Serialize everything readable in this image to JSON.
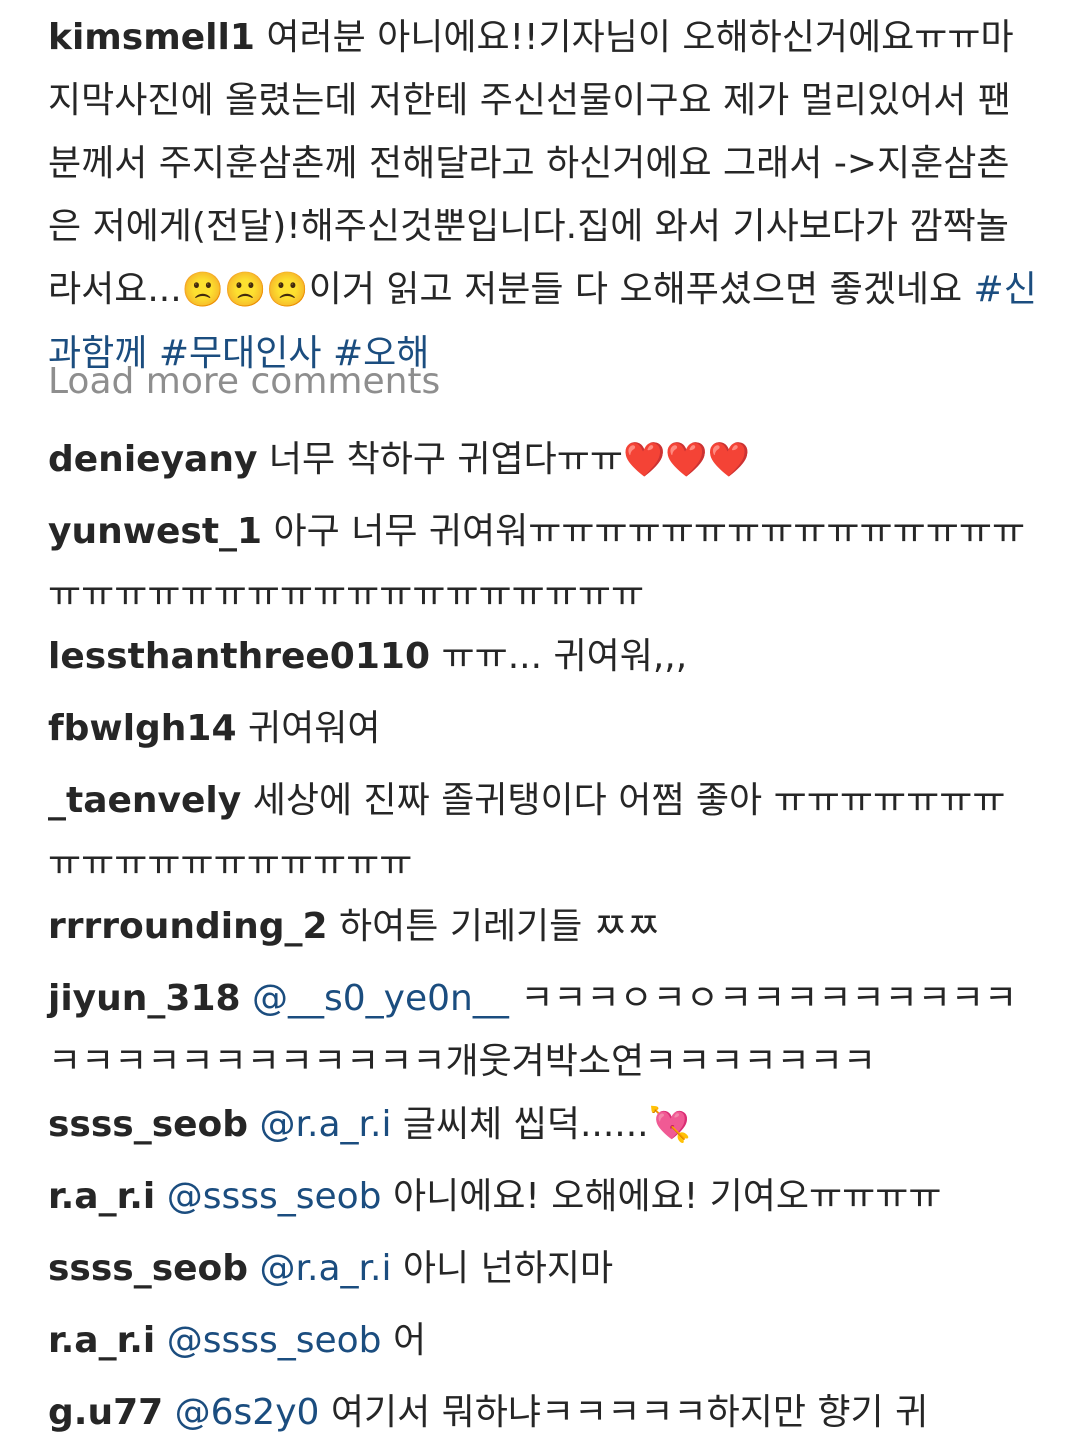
{
  "caption": {
    "username": "kimsmell1",
    "text_part1": "여러분 아니에요!!기자님이 오해하신거에요ㅠㅠ마지막사진에 올렸는데 저한테 주신선물이구요 제가 멀리있어서 팬분께서 주지훈삼촌께 전해달라고 하신거에요 그래서 ->지훈삼촌은 저에게(전달)!해주신것뿐입니다.집에 와서 기사보다가 깜짝놀라서요...",
    "emojis": "🙁🙁🙁",
    "text_part2": "이거 읽고 저분들 다 오해푸셨으면 좋겠네요 ",
    "hashtags": [
      "#신과함께",
      "#무대인사",
      "#오해"
    ]
  },
  "load_more_label": "Load more comments",
  "comments": [
    {
      "username": "denieyany",
      "mention": "",
      "text": "너무 착하구 귀엽다ㅠㅠ",
      "emoji": "❤️❤️❤️"
    },
    {
      "username": "yunwest_1",
      "mention": "",
      "text": "아구 너무 귀여워ㅠㅠㅠㅠㅠㅠㅠㅠㅠㅠㅠㅠㅠㅠㅠㅠㅠㅠㅠㅠㅠㅠㅠㅠㅠㅠㅠㅠㅠㅠㅠㅠㅠ",
      "emoji": ""
    },
    {
      "username": "lessthanthree0110",
      "mention": "",
      "text": "ㅠㅠ... 귀여워,,,",
      "emoji": ""
    },
    {
      "username": "fbwlgh14",
      "mention": "",
      "text": "귀여워여",
      "emoji": ""
    },
    {
      "username": "_taenvely",
      "mention": "",
      "text": "세상에 진짜 졸귀탱이다 어쩜 좋아 ㅠㅠㅠㅠㅠㅠㅠㅠㅠㅠㅠㅠㅠㅠㅠㅠㅠㅠ",
      "emoji": ""
    },
    {
      "username": "rrrrounding_2",
      "mention": "",
      "text": "하여튼 기레기들 ㅉㅉ",
      "emoji": ""
    },
    {
      "username": "jiyun_318",
      "mention": "@__s0_ye0n__",
      "text": "ㅋㅋㅋㅇㅋㅇㅋㅋㅋㅋㅋㅋㅋㅋㅋㅋㅋㅋㅋㅋㅋㅋㅋㅋㅋㅋㅋ개웃겨박소연ㅋㅋㅋㅋㅋㅋㅋ",
      "emoji": ""
    },
    {
      "username": "ssss_seob",
      "mention": "@r.a_r.i",
      "text": "글씨체 씹덕......",
      "emoji": "💘"
    },
    {
      "username": "r.a_r.i",
      "mention": "@ssss_seob",
      "text": "아니에요! 오해에요! 기여오ㅠㅠㅠㅠ",
      "emoji": ""
    },
    {
      "username": "ssss_seob",
      "mention": "@r.a_r.i",
      "text": "아니 넌하지마",
      "emoji": ""
    },
    {
      "username": "r.a_r.i",
      "mention": "@ssss_seob",
      "text": "어",
      "emoji": ""
    },
    {
      "username": "g.u77",
      "mention": "@6s2y0",
      "text": "여기서 뭐하냐ㅋㅋㅋㅋㅋ하지만 향기 귀",
      "emoji": ""
    }
  ]
}
